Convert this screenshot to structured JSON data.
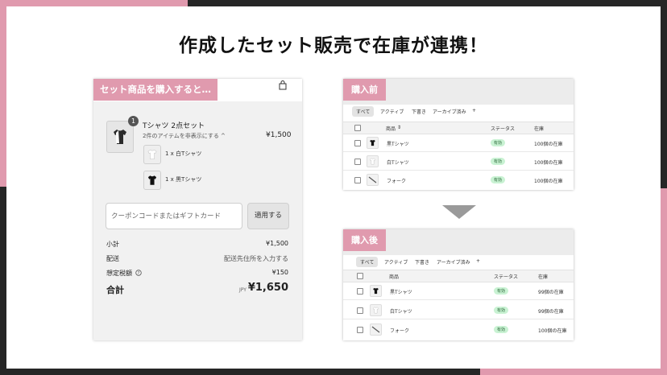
{
  "colors": {
    "accent_pink": "#e09aae",
    "frame_dark": "#262626",
    "status_green": "#c9f2d3"
  },
  "title": "作成したセット販売で在庫が連携！",
  "cart": {
    "tag": "セット商品を購入すると…",
    "bag_icon": "shopping-bag-icon",
    "item": {
      "qty_badge": "1",
      "name": "Tシャツ 2点セット",
      "toggle": "2件のアイテムを非表示にする ^",
      "price": "¥1,500",
      "sub_items": [
        "1 x 白Tシャツ",
        "1 x 黒Tシャツ"
      ]
    },
    "coupon_placeholder": "クーポンコードまたはギフトカード",
    "apply_label": "適用する",
    "summary": [
      {
        "label": "小計",
        "value": "¥1,500"
      },
      {
        "label": "配送",
        "value": "配送先住所を入力する"
      },
      {
        "label": "想定税額",
        "value": "¥150"
      }
    ],
    "total_label": "合計",
    "currency": "JPY",
    "total_value": "¥1,650"
  },
  "before": {
    "tag": "購入前",
    "tabs": [
      "すべて",
      "アクティブ",
      "下書き",
      "アーカイブ済み",
      "+"
    ],
    "columns": [
      "商品",
      "ステータス",
      "在庫"
    ],
    "rows": [
      {
        "name": "黒Tシャツ",
        "status": "有効",
        "stock": "100個の在庫"
      },
      {
        "name": "白Tシャツ",
        "status": "有効",
        "stock": "100個の在庫"
      },
      {
        "name": "フォーク",
        "status": "有効",
        "stock": "100個の在庫"
      }
    ]
  },
  "after": {
    "tag": "購入後",
    "tabs": [
      "すべて",
      "アクティブ",
      "下書き",
      "アーカイブ済み",
      "+"
    ],
    "columns": [
      "商品",
      "ステータス",
      "在庫"
    ],
    "rows": [
      {
        "name": "黒Tシャツ",
        "status": "有効",
        "stock": "99個の在庫"
      },
      {
        "name": "白Tシャツ",
        "status": "有効",
        "stock": "99個の在庫"
      },
      {
        "name": "フォーク",
        "status": "有効",
        "stock": "100個の在庫"
      }
    ]
  }
}
